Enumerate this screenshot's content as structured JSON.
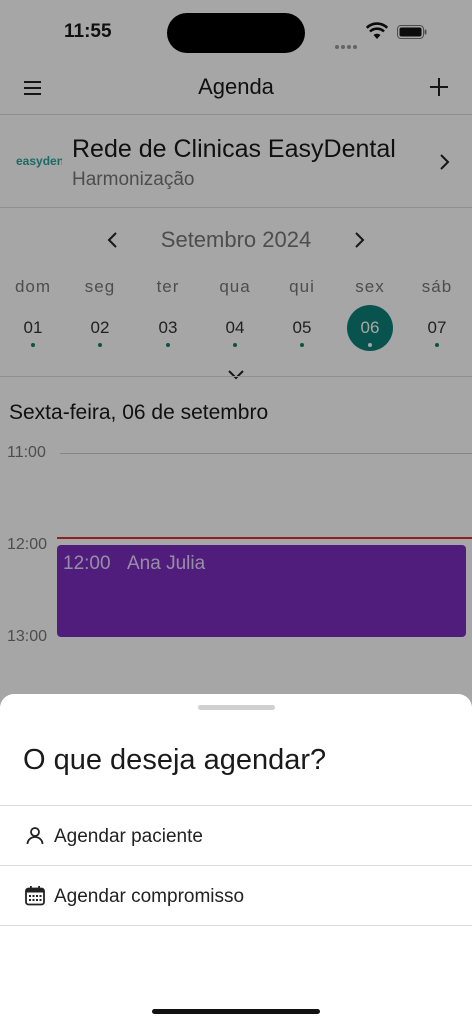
{
  "status": {
    "time": "11:55"
  },
  "header": {
    "title": "Agenda"
  },
  "clinic": {
    "logo_text": "easydental",
    "name": "Rede de Clinicas EasyDental",
    "subtitle": "Harmonização"
  },
  "calendar": {
    "month": "Setembro 2024",
    "weekdays": [
      "dom",
      "seg",
      "ter",
      "qua",
      "qui",
      "sex",
      "sáb"
    ],
    "days": [
      "01",
      "02",
      "03",
      "04",
      "05",
      "06",
      "07"
    ],
    "selected_index": 5
  },
  "schedule": {
    "day_title": "Sexta-feira, 06 de setembro",
    "hours": [
      "11:00",
      "12:00",
      "13:00"
    ],
    "event": {
      "time": "12:00",
      "name": "Ana Julia",
      "color": "#7b2dbf"
    }
  },
  "sheet": {
    "title": "O que deseja agendar?",
    "options": [
      {
        "label": "Agendar paciente",
        "icon": "person-icon"
      },
      {
        "label": "Agendar compromisso",
        "icon": "calendar-icon"
      }
    ]
  },
  "colors": {
    "accent": "#0f807a",
    "event": "#7b2dbf",
    "now_line": "#dd3333"
  }
}
